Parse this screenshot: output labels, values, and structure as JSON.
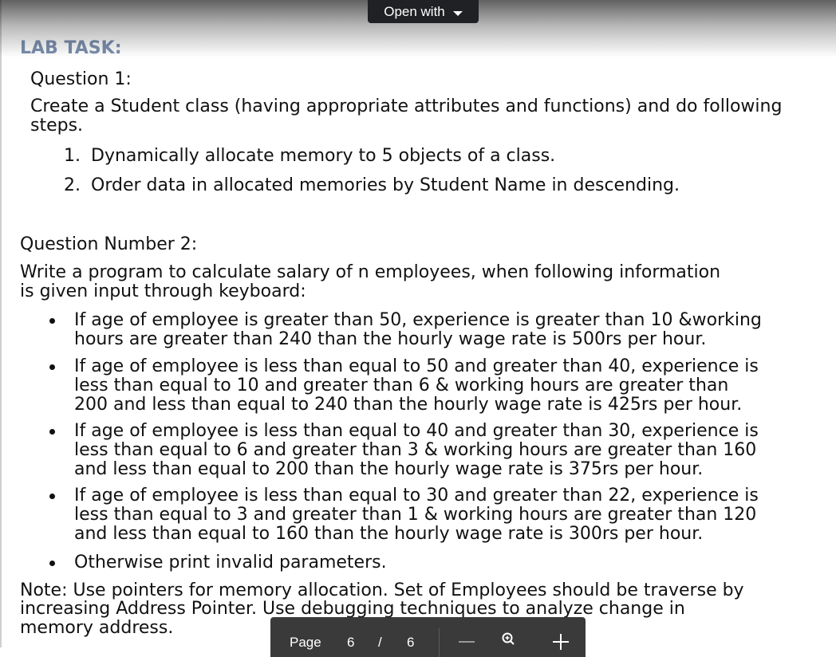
{
  "viewer": {
    "open_with_label": "Open with",
    "page_label": "Page",
    "current_page": "6",
    "separator": "/",
    "total_pages": "6"
  },
  "doc": {
    "lab_title": "LAB TASK:",
    "q1_heading": "Question 1:",
    "q1_text_line1": "Create a Student class (having appropriate attributes and functions) and do following",
    "q1_text_line2": "steps.",
    "q1_steps": [
      {
        "num": "1.",
        "text": "Dynamically allocate memory to 5 objects of a class."
      },
      {
        "num": "2.",
        "text": "Order data in allocated memories by Student Name in descending."
      }
    ],
    "q2_heading": "Question Number 2:",
    "q2_intro_line1": "Write a program to calculate salary of n employees, when following information",
    "q2_intro_line2": "is given input through keyboard:",
    "q2_bullets": [
      {
        "lines": [
          "If age of employee is greater than 50, experience is greater than 10 &working",
          "hours are greater than 240 than the hourly wage rate is 500rs per hour."
        ]
      },
      {
        "lines": [
          "If age of employee is less than equal to 50 and greater than 40, experience is",
          "less than equal to 10 and greater than 6 & working hours are greater than",
          "200 and less than equal to 240 than the hourly wage rate is 425rs per hour."
        ]
      },
      {
        "lines": [
          "If age of employee is less than equal to 40 and greater than 30, experience is",
          "less than equal to 6 and greater than 3 & working hours are greater than 160",
          "and less than equal to 200 than the hourly wage rate is 375rs per hour."
        ]
      },
      {
        "lines": [
          "If age of employee is less than equal to 30 and greater than 22, experience is",
          "less than equal to 3 and greater than 1 & working hours are greater than 120",
          "and less than equal to 160 than the hourly wage rate is 300rs per hour."
        ]
      },
      {
        "lines": [
          "Otherwise print invalid parameters."
        ]
      }
    ],
    "note_line1": "Note: Use pointers for memory allocation. Set of Employees should be traverse by",
    "note_line2": "increasing Address Pointer. Use debugging techniques to analyze change in",
    "note_line3": "memory address."
  }
}
